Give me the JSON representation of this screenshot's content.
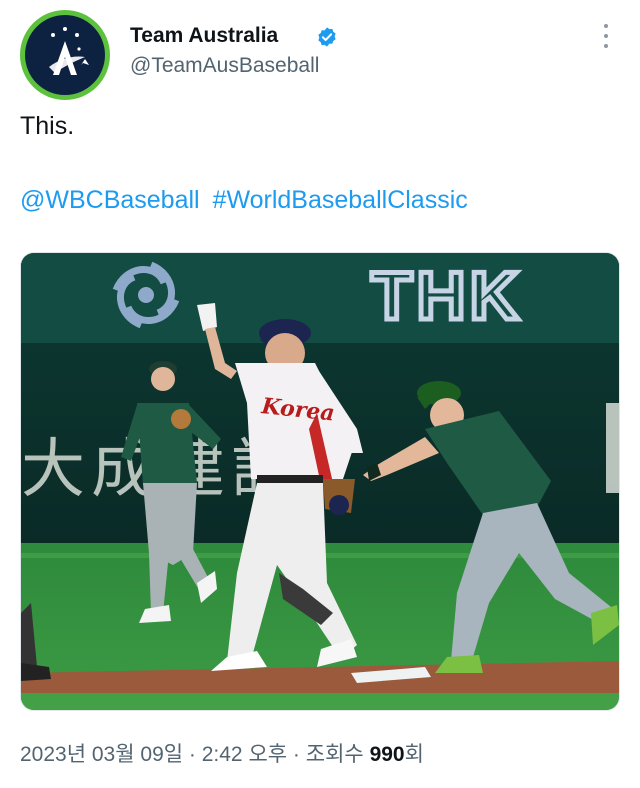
{
  "profile": {
    "display_name": "Team Australia",
    "handle": "@TeamAusBaseball",
    "verified_icon": "verified-badge-icon",
    "accent": "#1d9bf0",
    "avatar_ring": "#5cc13c"
  },
  "tweet": {
    "text": "This.",
    "tags": [
      "@WBCBaseball",
      "#WorldBaseballClassic"
    ]
  },
  "photo": {
    "jersey_text": "Korea",
    "board_text": "THK",
    "wall_chars": "大成建設"
  },
  "meta": {
    "date": "2023년 03월 09일",
    "sep1": " · ",
    "time": "2:42 오후",
    "sep2": " · ",
    "views_label": "조회수 ",
    "views_count": "990",
    "views_unit": "회"
  }
}
